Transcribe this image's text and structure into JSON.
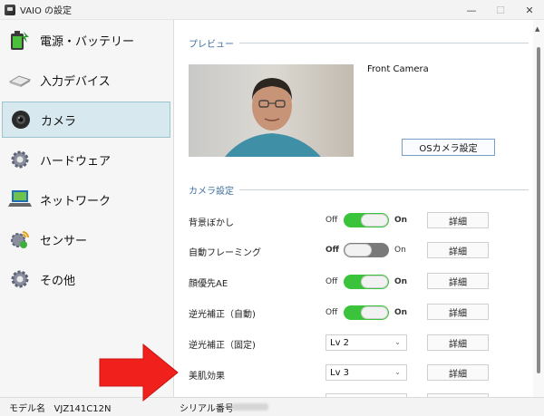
{
  "window": {
    "title": "VAIO の設定",
    "minimize": "—",
    "maximize": "☐",
    "close": "✕"
  },
  "sidebar": {
    "items": [
      {
        "label": "電源・バッテリー",
        "icon": "battery-icon"
      },
      {
        "label": "入力デバイス",
        "icon": "keyboard-icon"
      },
      {
        "label": "カメラ",
        "icon": "camera-icon",
        "active": true
      },
      {
        "label": "ハードウェア",
        "icon": "gear-icon"
      },
      {
        "label": "ネットワーク",
        "icon": "network-icon"
      },
      {
        "label": "センサー",
        "icon": "sensor-icon"
      },
      {
        "label": "その他",
        "icon": "settings-icon"
      }
    ]
  },
  "preview": {
    "section_title": "プレビュー",
    "camera_name": "Front Camera",
    "os_camera_button": "OSカメラ設定"
  },
  "camera_settings": {
    "section_title": "カメラ設定",
    "rows": [
      {
        "label": "背景ぼかし",
        "type": "toggle",
        "state": "on",
        "off": "Off",
        "on": "On",
        "detail": "詳細"
      },
      {
        "label": "自動フレーミング",
        "type": "toggle",
        "state": "off",
        "off": "Off",
        "on": "On",
        "detail": "詳細"
      },
      {
        "label": "顔優先AE",
        "type": "toggle",
        "state": "on",
        "off": "Off",
        "on": "On",
        "detail": "詳細"
      },
      {
        "label": "逆光補正（自動)",
        "type": "toggle",
        "state": "on",
        "off": "Off",
        "on": "On",
        "detail": "詳細"
      },
      {
        "label": "逆光補正（固定)",
        "type": "select",
        "value": "Lv 2",
        "detail": "詳細"
      },
      {
        "label": "美肌効果",
        "type": "select",
        "value": "Lv 3",
        "detail": "詳細"
      }
    ]
  },
  "statusbar": {
    "model_label": "モデル名",
    "model_value": "VJZ141C12N",
    "serial_label": "シリアル番号"
  },
  "colors": {
    "accent_blue": "#3f6f9e",
    "toggle_on": "#3cc33c",
    "toggle_off": "#7a7a7a",
    "active_nav_bg": "#d7e9ee",
    "annotation_arrow": "#f0201c"
  }
}
